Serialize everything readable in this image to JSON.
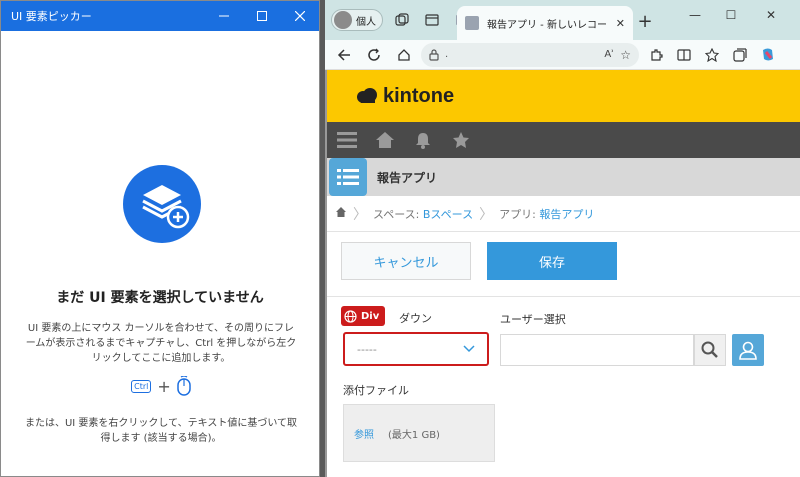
{
  "picker": {
    "title": "UI 要素ピッカー",
    "heading": "まだ UI 要素を選択していません",
    "description": "UI 要素の上にマウス カーソルを合わせて、その周りにフレームが表示されるまでキャプチャし、Ctrl を押しながら左クリックしてここに追加します。",
    "ctrl_key": "Ctrl",
    "plus": "+",
    "note": "または、UI 要素を右クリックして、テキスト値に基づいて取得します (該当する場合)。"
  },
  "browser": {
    "profile_label": "個人",
    "active_tab_title": "報告アプリ - 新しいレコード",
    "new_tab": "+",
    "url": ".",
    "read_aloud": "Aʾ"
  },
  "kintone": {
    "logo_text": "kintone",
    "app_title": "報告アプリ",
    "breadcrumb": {
      "space_prefix": "スペース: ",
      "space_name": "Bスペース",
      "app_prefix": "アプリ: ",
      "app_name": "報告アプリ"
    },
    "cancel_label": "キャンセル",
    "save_label": "保存",
    "dropdown_label": "ダウン",
    "dropdown_value": "-----",
    "div_badge": "Div",
    "user_select_label": "ユーザー選択",
    "attachment_label": "添付ファイル",
    "browse_label": "参照",
    "max_size": "(最大1 GB)"
  },
  "colors": {
    "picker_titlebar": "#1a6fe0",
    "kintone_yellow": "#fcc800",
    "kintone_blue": "#3498db",
    "highlight_red": "#cc1c1c"
  }
}
